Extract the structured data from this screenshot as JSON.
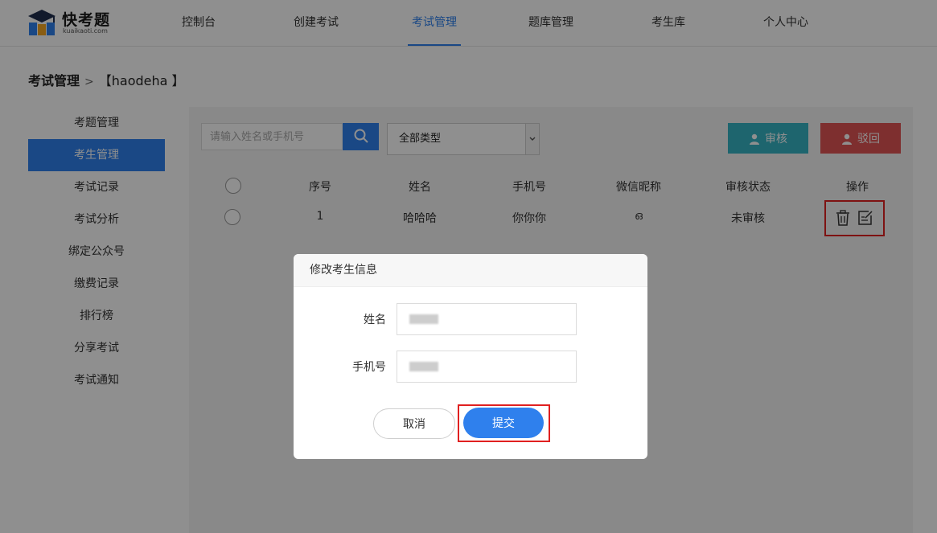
{
  "brand": {
    "name": "快考题",
    "domain": "kuaikaoti.com"
  },
  "nav": {
    "items": [
      "控制台",
      "创建考试",
      "考试管理",
      "题库管理",
      "考生库",
      "个人中心"
    ],
    "active_index": 2
  },
  "breadcrumb": {
    "root": "考试管理",
    "separator": ">",
    "current": "【haodeha 】"
  },
  "sidebar": {
    "items": [
      "考题管理",
      "考生管理",
      "考试记录",
      "考试分析",
      "绑定公众号",
      "缴费记录",
      "排行榜",
      "分享考试",
      "考试通知"
    ],
    "active_index": 1
  },
  "toolbar": {
    "search_placeholder": "请输入姓名或手机号",
    "type_select": "全部类型",
    "approve_label": "审核",
    "reject_label": "驳回"
  },
  "table": {
    "headers": [
      "序号",
      "姓名",
      "手机号",
      "微信昵称",
      "审核状态",
      "操作"
    ],
    "rows": [
      {
        "index": "1",
        "name": "哈哈哈",
        "phone": "你你你",
        "wechat": "ഒ",
        "status": "未审核"
      }
    ]
  },
  "modal": {
    "title": "修改考生信息",
    "name_label": "姓名",
    "phone_label": "手机号",
    "name_value": "",
    "phone_value": "",
    "cancel_label": "取消",
    "submit_label": "提交"
  },
  "colors": {
    "accent": "#2f80ed",
    "approve": "#36b5c4",
    "reject": "#e05555",
    "highlight": "#e02020"
  }
}
